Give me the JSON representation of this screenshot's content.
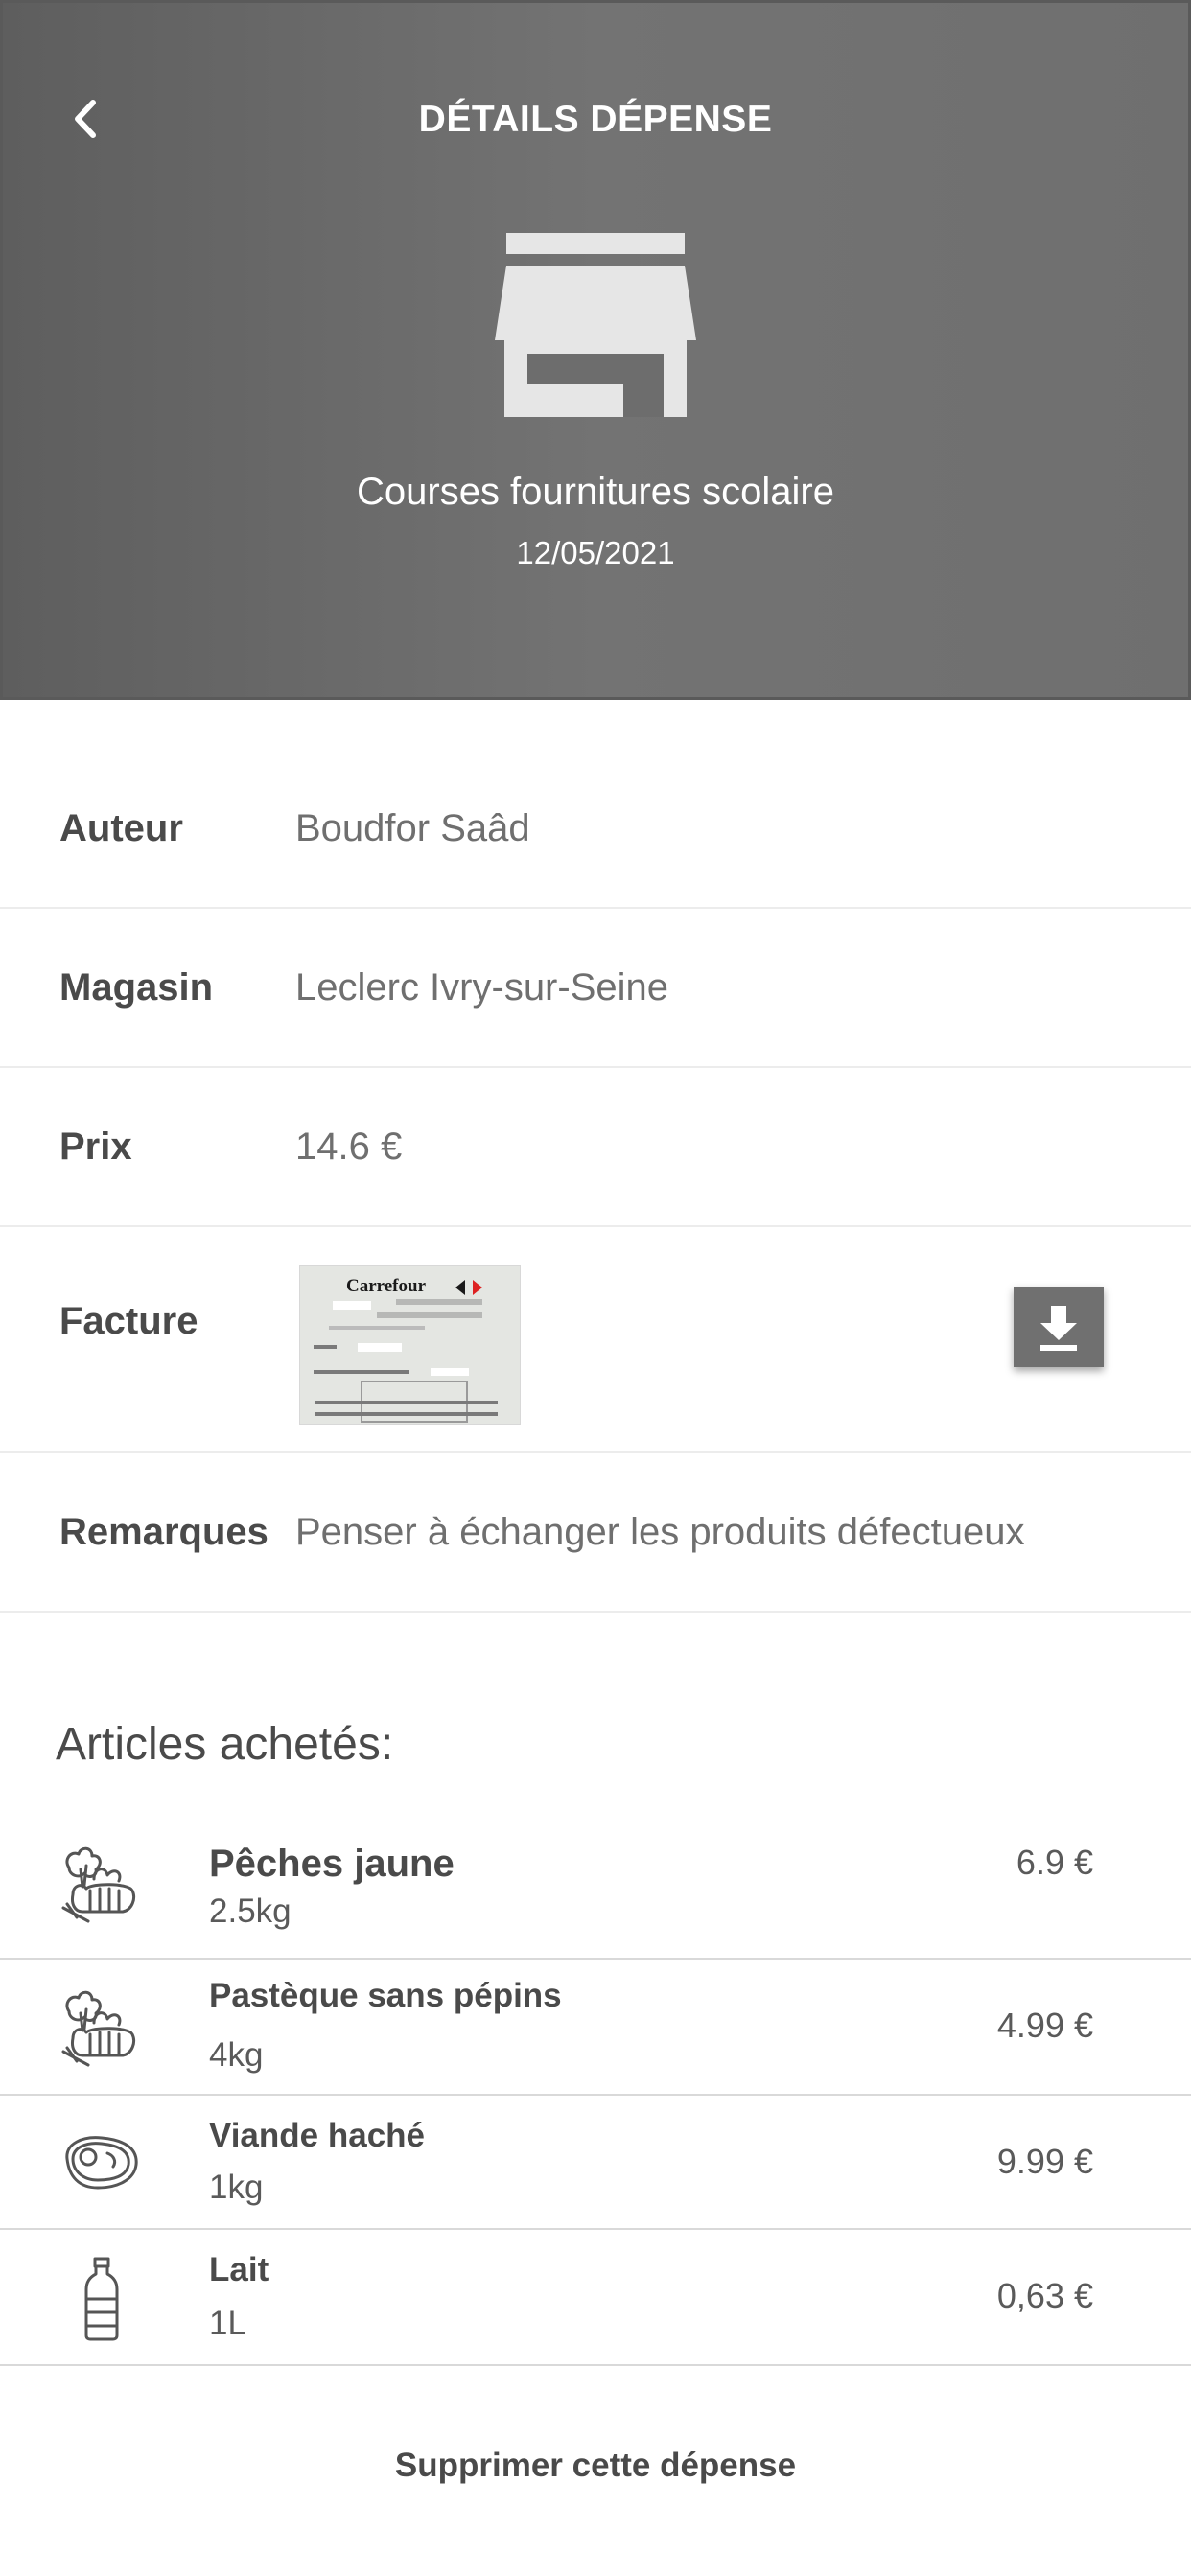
{
  "header": {
    "title": "DÉTAILS DÉPENSE",
    "back_icon": "chevron-left-icon",
    "store_icon": "store-icon",
    "expense_name": "Courses fournitures scolaire",
    "expense_date": "12/05/2021",
    "background_color": "#6b6b6b"
  },
  "details": {
    "author_label": "Auteur",
    "author_value": "Boudfor Saâd",
    "store_label": "Magasin",
    "store_value": "Leclerc Ivry-sur-Seine",
    "price_label": "Prix",
    "price_value": "14.6 €",
    "invoice_label": "Facture",
    "invoice_thumb_brand": "Carrefour",
    "download_icon": "download-icon",
    "remarks_label": "Remarques",
    "remarks_value": "Penser à échanger les produits défectueux"
  },
  "articles": {
    "title": "Articles achetés:",
    "items": [
      {
        "name": "Pêches jaune",
        "qty": "2.5kg",
        "price": "6.9 €",
        "icon": "vegetables-icon"
      },
      {
        "name": "Pastèque sans pépins",
        "qty": "4kg",
        "price": "4.99 €",
        "icon": "vegetables-icon"
      },
      {
        "name": "Viande haché",
        "qty": "1kg",
        "price": "9.99 €",
        "icon": "steak-icon"
      },
      {
        "name": "Lait",
        "qty": "1L",
        "price": "0,63 €",
        "icon": "bottle-icon"
      }
    ]
  },
  "actions": {
    "delete_label": "Supprimer cette dépense"
  }
}
